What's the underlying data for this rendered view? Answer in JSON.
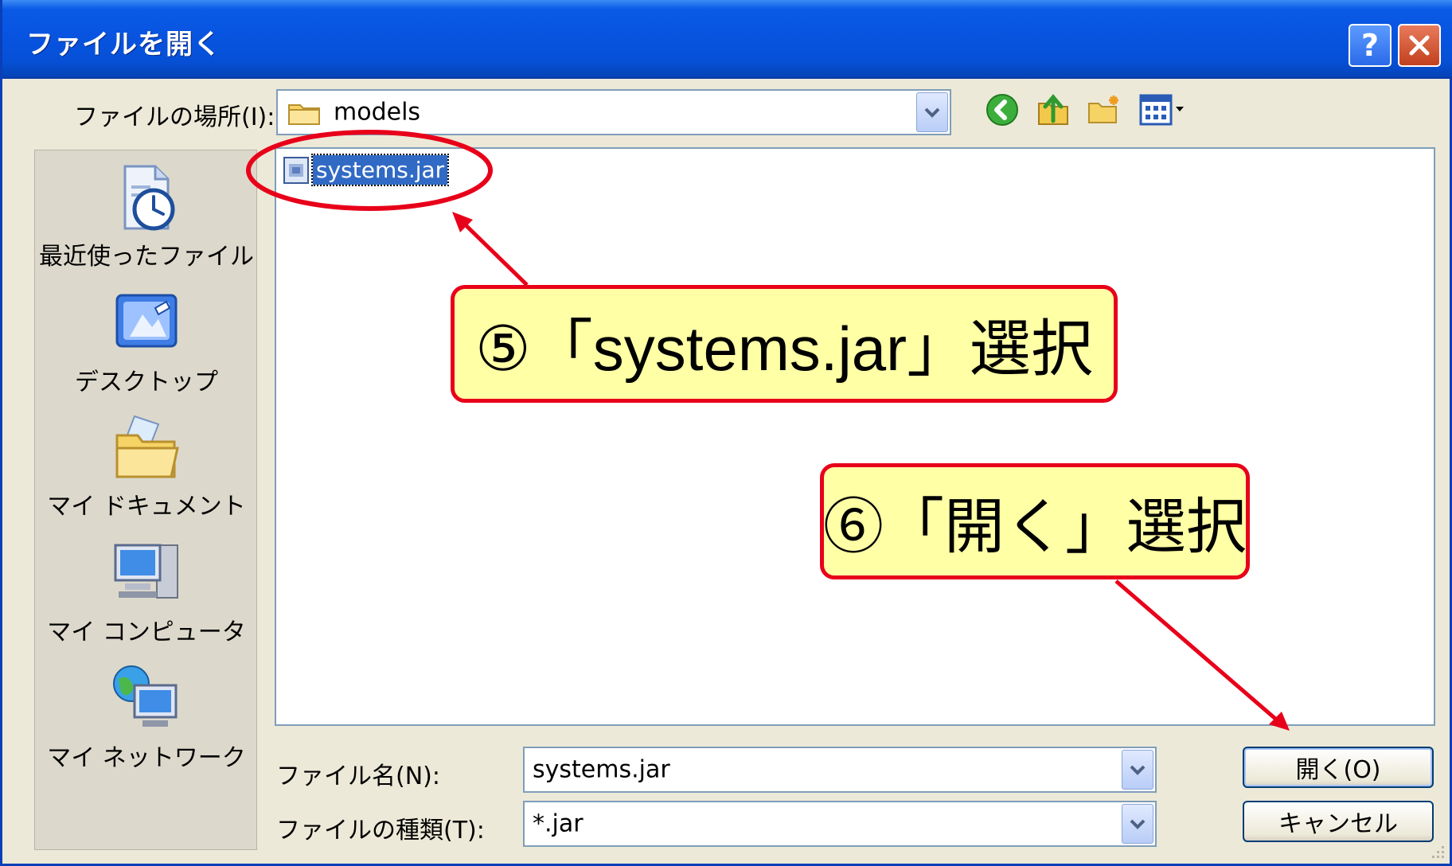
{
  "window": {
    "title": "ファイルを開く"
  },
  "location": {
    "label": "ファイルの場所(I):",
    "value": "models"
  },
  "places": [
    {
      "label": "最近使ったファイル",
      "icon": "recent-files-icon"
    },
    {
      "label": "デスクトップ",
      "icon": "desktop-icon"
    },
    {
      "label": "マイ ドキュメント",
      "icon": "my-documents-icon"
    },
    {
      "label": "マイ コンピュータ",
      "icon": "my-computer-icon"
    },
    {
      "label": "マイ ネットワーク",
      "icon": "my-network-icon"
    }
  ],
  "files": [
    {
      "name": "systems.jar",
      "selected": true
    }
  ],
  "filename": {
    "label": "ファイル名(N):",
    "value": "systems.jar"
  },
  "filetype": {
    "label": "ファイルの種類(T):",
    "value": "*.jar"
  },
  "buttons": {
    "open": "開く(O)",
    "cancel": "キャンセル"
  },
  "annotations": {
    "step5": "⑤「systems.jar」選択",
    "step6": "⑥「開く」選択"
  },
  "colors": {
    "titlebar": "#0854e0",
    "selection": "#316ac5",
    "callout_fill": "#ffffa6",
    "callout_border": "#e8001a"
  }
}
